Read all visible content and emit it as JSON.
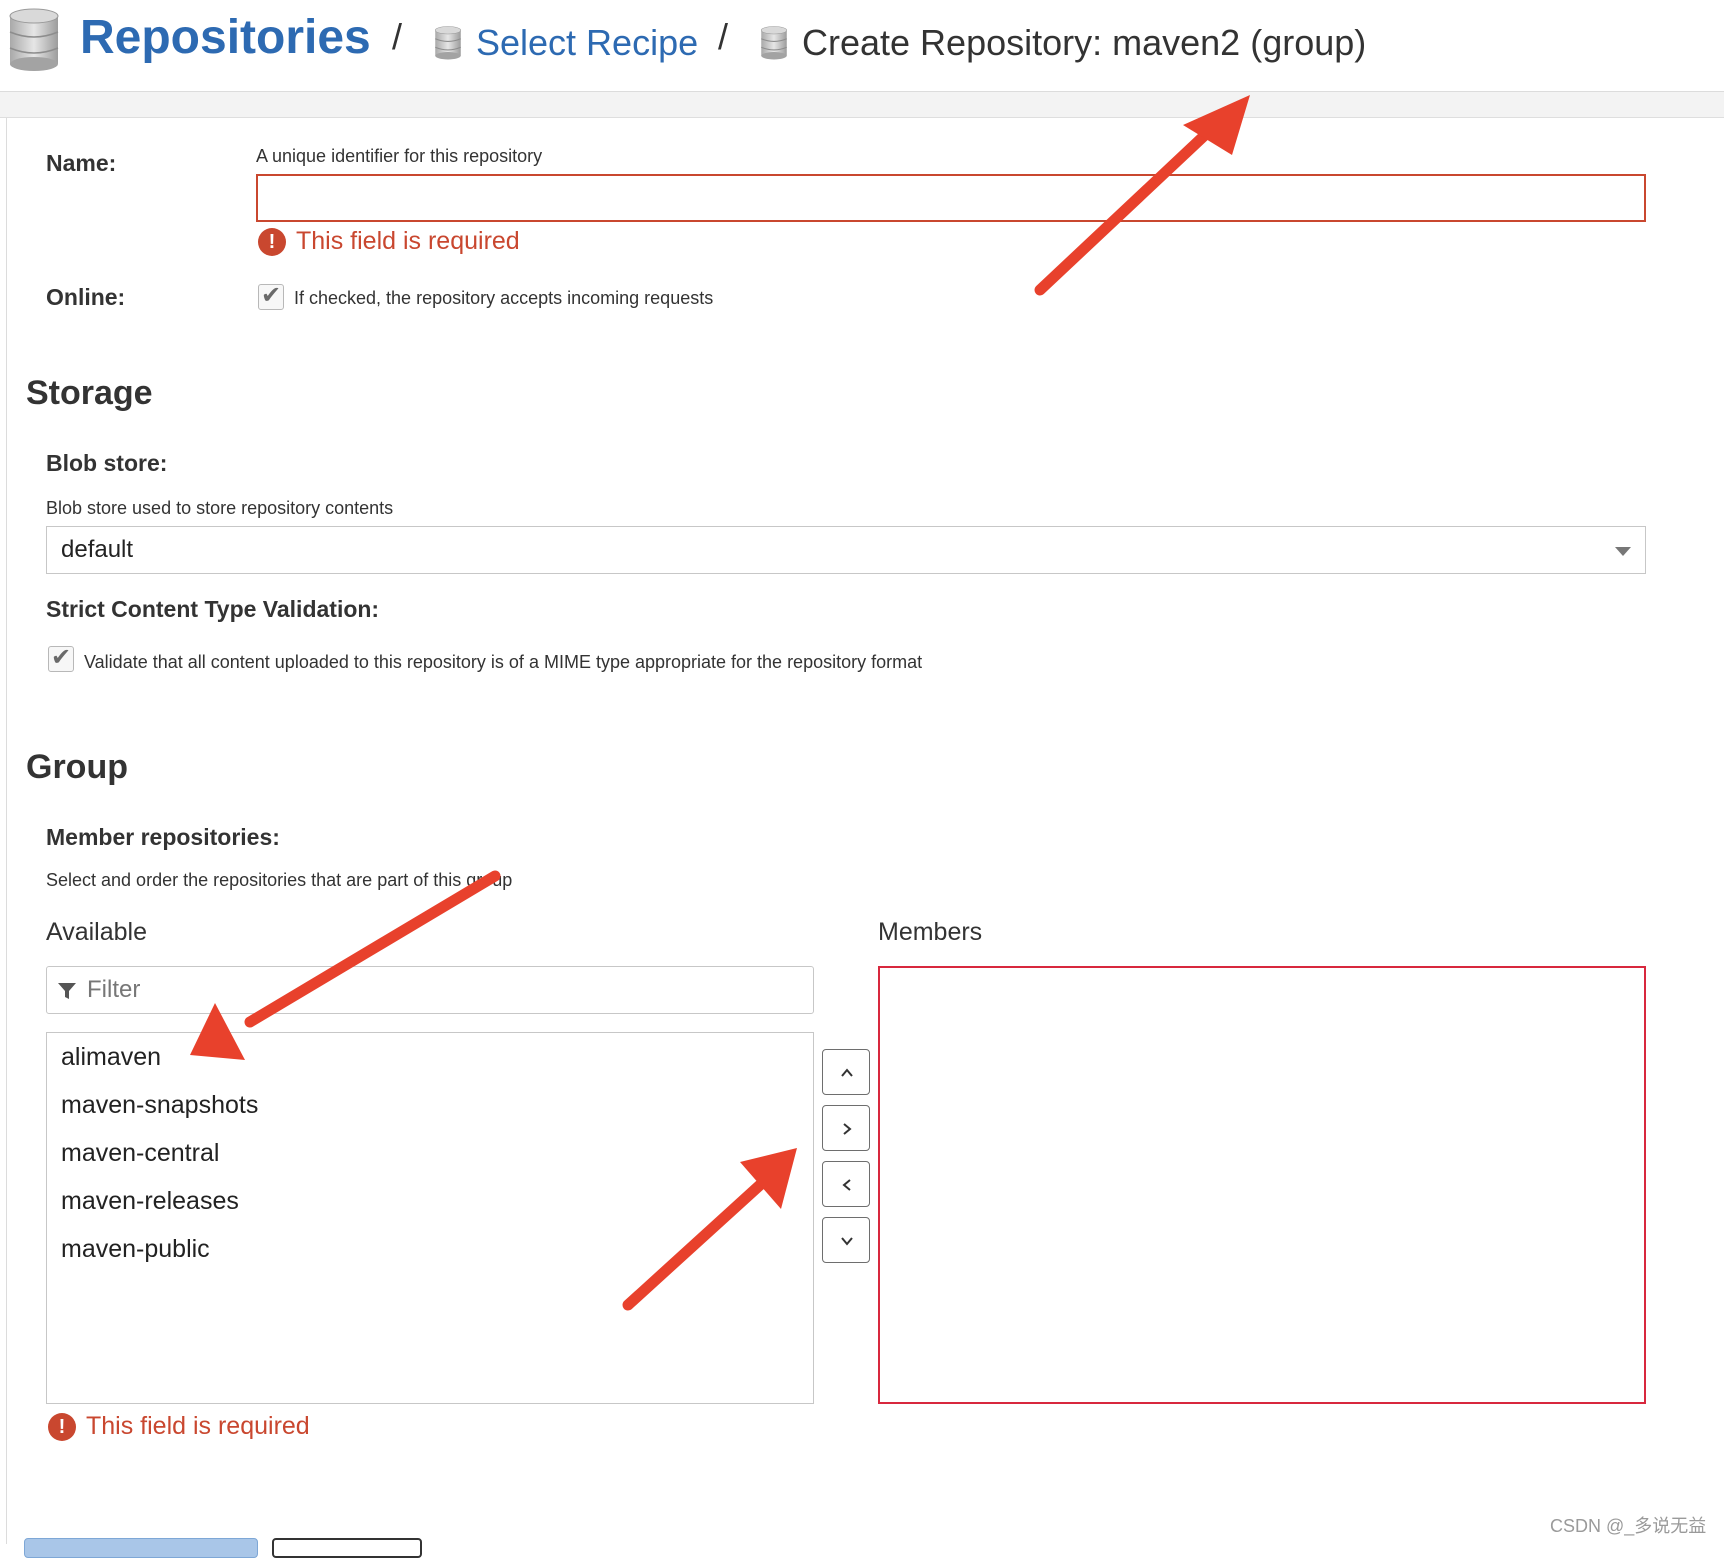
{
  "breadcrumb": {
    "root": "Repositories",
    "separator": "/",
    "link": "Select Recipe",
    "current": "Create Repository: maven2 (group)"
  },
  "form": {
    "name": {
      "label": "Name:",
      "help": "A unique identifier for this repository",
      "value": "",
      "error": "This field is required"
    },
    "online": {
      "label": "Online:",
      "help": "If checked, the repository accepts incoming requests",
      "checked": true
    }
  },
  "storage": {
    "title": "Storage",
    "blob_store": {
      "label": "Blob store:",
      "help": "Blob store used to store repository contents",
      "selected": "default"
    },
    "strict_validation": {
      "label": "Strict Content Type Validation:",
      "help": "Validate that all content uploaded to this repository is of a MIME type appropriate for the repository format",
      "checked": true
    }
  },
  "group": {
    "title": "Group",
    "members_label": "Member repositories:",
    "members_help": "Select and order the repositories that are part of this group",
    "available_title": "Available",
    "members_title": "Members",
    "filter_placeholder": "Filter",
    "available": [
      "alimaven",
      "maven-snapshots",
      "maven-central",
      "maven-releases",
      "maven-public"
    ],
    "members": [],
    "error": "This field is required"
  },
  "icons": {
    "error_glyph": "!",
    "check_glyph": "✔"
  },
  "watermark": "CSDN @_多说无益",
  "colors": {
    "link": "#2d6ab2",
    "error": "#c9472f",
    "members_border": "#d8283e",
    "annotation_arrow": "#e8412c"
  }
}
